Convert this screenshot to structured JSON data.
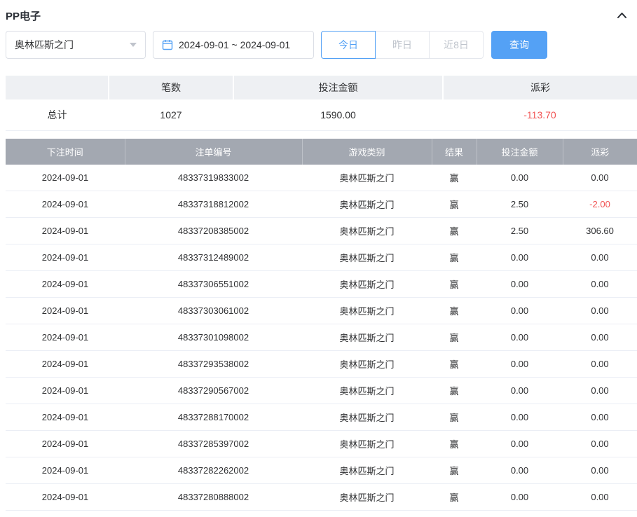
{
  "colors": {
    "accent": "#54a1f5",
    "negative": "#f15353",
    "table_header_bg": "#a3a8b1",
    "summary_header_bg": "#eef0f3"
  },
  "header": {
    "title": "PP电子"
  },
  "filters": {
    "game_select_value": "奥林匹斯之门",
    "date_range": "2024-09-01 ~ 2024-09-01",
    "quick_buttons": [
      {
        "label": "今日",
        "active": true
      },
      {
        "label": "昨日",
        "active": false
      },
      {
        "label": "近8日",
        "active": false
      }
    ],
    "query_label": "查询"
  },
  "summary": {
    "headers": [
      "",
      "笔数",
      "投注金额",
      "派彩"
    ],
    "row": [
      "总计",
      "1027",
      "1590.00",
      "-113.70"
    ]
  },
  "table": {
    "headers": [
      "下注时间",
      "注单编号",
      "游戏类别",
      "结果",
      "投注金额",
      "派彩"
    ],
    "rows": [
      [
        "2024-09-01",
        "48337319833002",
        "奥林匹斯之门",
        "赢",
        "0.00",
        "0.00"
      ],
      [
        "2024-09-01",
        "48337318812002",
        "奥林匹斯之门",
        "赢",
        "2.50",
        "-2.00"
      ],
      [
        "2024-09-01",
        "48337208385002",
        "奥林匹斯之门",
        "赢",
        "2.50",
        "306.60"
      ],
      [
        "2024-09-01",
        "48337312489002",
        "奥林匹斯之门",
        "赢",
        "0.00",
        "0.00"
      ],
      [
        "2024-09-01",
        "48337306551002",
        "奥林匹斯之门",
        "赢",
        "0.00",
        "0.00"
      ],
      [
        "2024-09-01",
        "48337303061002",
        "奥林匹斯之门",
        "赢",
        "0.00",
        "0.00"
      ],
      [
        "2024-09-01",
        "48337301098002",
        "奥林匹斯之门",
        "赢",
        "0.00",
        "0.00"
      ],
      [
        "2024-09-01",
        "48337293538002",
        "奥林匹斯之门",
        "赢",
        "0.00",
        "0.00"
      ],
      [
        "2024-09-01",
        "48337290567002",
        "奥林匹斯之门",
        "赢",
        "0.00",
        "0.00"
      ],
      [
        "2024-09-01",
        "48337288170002",
        "奥林匹斯之门",
        "赢",
        "0.00",
        "0.00"
      ],
      [
        "2024-09-01",
        "48337285397002",
        "奥林匹斯之门",
        "赢",
        "0.00",
        "0.00"
      ],
      [
        "2024-09-01",
        "48337282262002",
        "奥林匹斯之门",
        "赢",
        "0.00",
        "0.00"
      ],
      [
        "2024-09-01",
        "48337280888002",
        "奥林匹斯之门",
        "赢",
        "0.00",
        "0.00"
      ]
    ]
  }
}
